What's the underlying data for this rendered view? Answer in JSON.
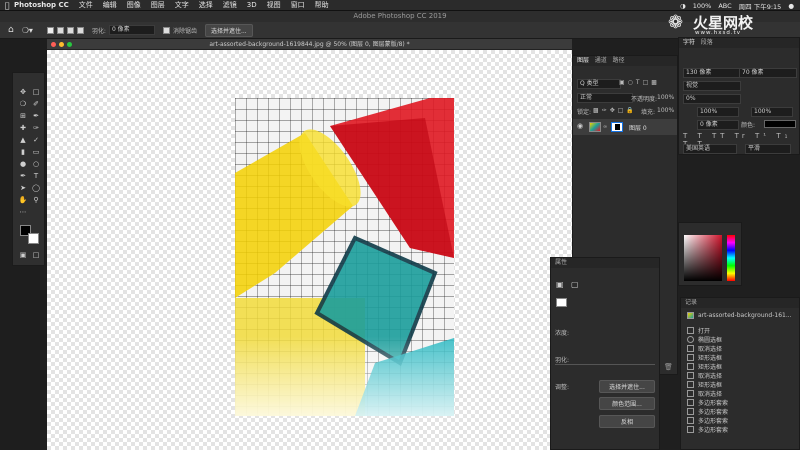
{
  "menubar": {
    "app_name": "Photoshop CC",
    "items": [
      "文件",
      "编辑",
      "图像",
      "图层",
      "文字",
      "选择",
      "滤镜",
      "3D",
      "视图",
      "窗口",
      "帮助"
    ],
    "battery": "100%",
    "input_method": "ABC",
    "clock": "周四 下午9:15"
  },
  "window": {
    "title": "Adobe Photoshop CC 2019"
  },
  "options": {
    "feather_label": "羽化:",
    "feather_value": "0 像素",
    "antialias_label": "消除锯齿",
    "select_mask_button": "选择并遮住..."
  },
  "document": {
    "tab_title": "art-assorted-background-1619844.jpg @ 50% (图层 0, 图层蒙版/8) *"
  },
  "layers_panel": {
    "tabs": [
      "图层",
      "通道",
      "路径"
    ],
    "kind": "Q 类型",
    "blend_mode": "正常",
    "opacity_label": "不透明度:",
    "opacity_value": "100%",
    "lock_label": "锁定:",
    "fill_label": "填充:",
    "fill_value": "100%",
    "layer_name": "图层 0"
  },
  "character_panel": {
    "tabs": [
      "字符",
      "段落"
    ],
    "font_size": "130 像素",
    "leading": "70 像素",
    "tracking_label": "视觉",
    "percent": "0%",
    "scale_h": "100%",
    "scale_v": "100%",
    "baseline": "0 像素",
    "color_label": "颜色:",
    "language": "美国英语",
    "smoothing": "平滑"
  },
  "properties_panel": {
    "title": "属性",
    "density_label": "浓度:",
    "feather_label": "羽化:",
    "adjust_label": "调整:",
    "select_and_mask": "选择并遮住...",
    "color_range": "颜色范围...",
    "invert": "反相"
  },
  "history_panel": {
    "title": "记录",
    "snapshot": "art-assorted-background-161...",
    "items": [
      "打开",
      "椭圆选框",
      "取消选择",
      "矩形选框",
      "矩形选框",
      "取消选择",
      "矩形选框",
      "取消选择",
      "多边形套索",
      "多边形套索",
      "多边形套索",
      "多边形套索"
    ]
  },
  "watermark": {
    "brand": "火星网校",
    "url": "www.hxsd.tv"
  },
  "colors": {
    "accent": "#1473e6",
    "picker_red": "#d0142c"
  }
}
